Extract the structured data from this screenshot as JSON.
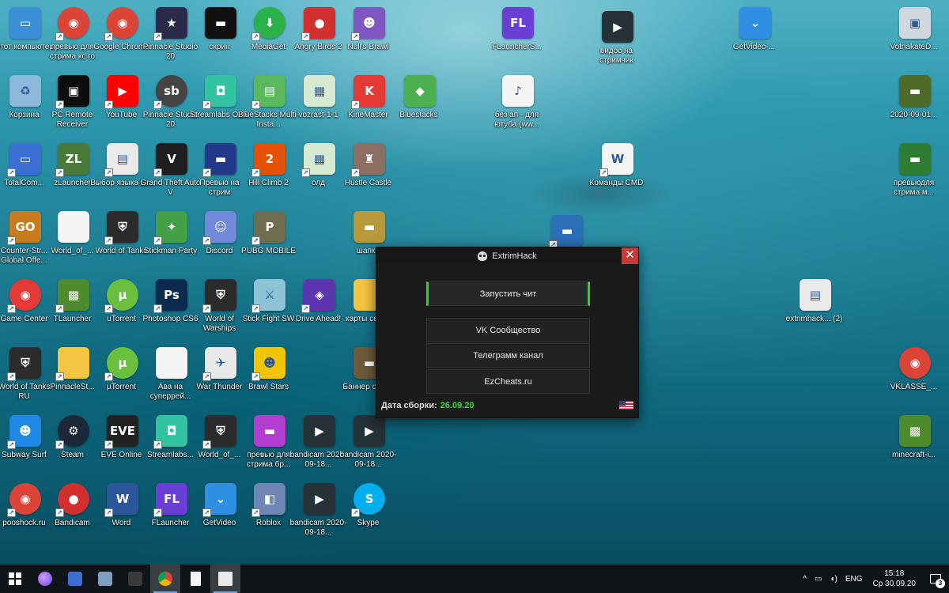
{
  "desktop": {
    "icons": [
      {
        "label": "Этот компьютер",
        "icon": "computer-icon",
        "color": "#3c8fd6",
        "glyph": "▭",
        "round": false,
        "shortcut": false
      },
      {
        "label": "превью для стрима кс го",
        "icon": "chrome-icon",
        "color": "#db4437",
        "glyph": "◉",
        "round": true,
        "shortcut": true
      },
      {
        "label": "Google Chrome",
        "icon": "chrome-icon",
        "color": "#db4437",
        "glyph": "◉",
        "round": true,
        "shortcut": true
      },
      {
        "label": "Pinnacle Studio 20",
        "icon": "pinnacle-icon",
        "color": "#2a2a4a",
        "glyph": "★",
        "round": false,
        "shortcut": true
      },
      {
        "label": "скрин",
        "icon": "image-icon",
        "color": "#111111",
        "glyph": "▬",
        "round": false,
        "shortcut": false
      },
      {
        "label": "MediaGet",
        "icon": "mediaget-icon",
        "color": "#2bb14a",
        "glyph": "⬇",
        "round": true,
        "shortcut": true
      },
      {
        "label": "Angry Birds 2",
        "icon": "angry-birds-icon",
        "color": "#d32f2f",
        "glyph": "●",
        "round": false,
        "shortcut": true
      },
      {
        "label": "Null's Brawl",
        "icon": "nulls-brawl-icon",
        "color": "#7e57c2",
        "glyph": "☻",
        "round": false,
        "shortcut": true
      },
      {
        "label": "Корзина",
        "icon": "recycle-bin-icon",
        "color": "#8fb7d9",
        "glyph": "♻",
        "round": false,
        "shortcut": false
      },
      {
        "label": "PC Remote Receiver",
        "icon": "pc-remote-icon",
        "color": "#0d0d0d",
        "glyph": "▣",
        "round": false,
        "shortcut": true
      },
      {
        "label": "YouTube",
        "icon": "youtube-icon",
        "color": "#ff0000",
        "glyph": "▶",
        "round": false,
        "shortcut": true
      },
      {
        "label": "Pinnacle Studio 20",
        "icon": "pinnacle-sb-icon",
        "color": "#444444",
        "glyph": "sb",
        "round": true,
        "shortcut": true
      },
      {
        "label": "Streamlabs OBS",
        "icon": "streamlabs-icon",
        "color": "#31c3a2",
        "glyph": "◘",
        "round": false,
        "shortcut": true
      },
      {
        "label": "BlueStacks Multi-Insta...",
        "icon": "bluestacks-icon",
        "color": "#5cb85c",
        "glyph": "▤",
        "round": false,
        "shortcut": true
      },
      {
        "label": "vozrast-1-1",
        "icon": "spreadsheet-icon",
        "color": "#d9ead3",
        "glyph": "▦",
        "round": false,
        "shortcut": false
      },
      {
        "label": "KineMaster",
        "icon": "kinemaster-icon",
        "color": "#e53935",
        "glyph": "K",
        "round": false,
        "shortcut": true
      },
      {
        "label": "Bluestacks",
        "icon": "bluestacks-stack-icon",
        "color": "#4caf50",
        "glyph": "◆",
        "round": false,
        "shortcut": false
      },
      {
        "label": "TotalCom...",
        "icon": "floppy-icon",
        "color": "#3b6fd4",
        "glyph": "▭",
        "round": false,
        "shortcut": true
      },
      {
        "label": "zLauncher",
        "icon": "zlauncher-icon",
        "color": "#4a7a3a",
        "glyph": "ZL",
        "round": false,
        "shortcut": true
      },
      {
        "label": "Выбор языка S...",
        "icon": "window-icon",
        "color": "#eaeaea",
        "glyph": "▤",
        "round": false,
        "shortcut": true
      },
      {
        "label": "Grand Theft Auto V",
        "icon": "gta-icon",
        "color": "#1e1e1e",
        "glyph": "V",
        "round": false,
        "shortcut": true
      },
      {
        "label": "Превью на стрим",
        "icon": "image-icon",
        "color": "#233a8a",
        "glyph": "▬",
        "round": false,
        "shortcut": true
      },
      {
        "label": "Hill Climb 2",
        "icon": "hill-climb-icon",
        "color": "#e65100",
        "glyph": "2",
        "round": false,
        "shortcut": true
      },
      {
        "label": "олд",
        "icon": "spreadsheet-icon",
        "color": "#d9ead3",
        "glyph": "▦",
        "round": false,
        "shortcut": true
      },
      {
        "label": "Hustle Castle",
        "icon": "hustle-castle-icon",
        "color": "#8d6e63",
        "glyph": "♜",
        "round": false,
        "shortcut": true
      },
      {
        "label": "Counter-Str... Global Offe...",
        "icon": "csgo-icon",
        "color": "#c77d1e",
        "glyph": "GO",
        "round": false,
        "shortcut": true
      },
      {
        "label": "World_of_...",
        "icon": "file-icon",
        "color": "#f5f5f5",
        "glyph": "",
        "round": false,
        "shortcut": false
      },
      {
        "label": "World of Tanks",
        "icon": "wot-icon",
        "color": "#2b2b2b",
        "glyph": "⛨",
        "round": false,
        "shortcut": true
      },
      {
        "label": "Stickman Party",
        "icon": "stickman-icon",
        "color": "#43a047",
        "glyph": "✦",
        "round": false,
        "shortcut": true
      },
      {
        "label": "Discord",
        "icon": "discord-icon",
        "color": "#7289da",
        "glyph": "☺",
        "round": false,
        "shortcut": true
      },
      {
        "label": "PUBG MOBILE",
        "icon": "pubg-icon",
        "color": "#6d6d4f",
        "glyph": "P",
        "round": false,
        "shortcut": true
      },
      {
        "label": "шапка",
        "icon": "image-icon",
        "color": "#b89a3a",
        "glyph": "▬",
        "round": false,
        "shortcut": false
      },
      {
        "label": "Game Center",
        "icon": "game-center-icon",
        "color": "#e53935",
        "glyph": "◉",
        "round": true,
        "shortcut": true
      },
      {
        "label": "TLauncher",
        "icon": "tlauncher-icon",
        "color": "#4e8b2c",
        "glyph": "▩",
        "round": false,
        "shortcut": true
      },
      {
        "label": "uTorrent",
        "icon": "utorrent-icon",
        "color": "#6abf3f",
        "glyph": "µ",
        "round": true,
        "shortcut": true
      },
      {
        "label": "Photoshop CS6",
        "icon": "photoshop-icon",
        "color": "#0b2a4e",
        "glyph": "Ps",
        "round": false,
        "shortcut": true
      },
      {
        "label": "World of Warships",
        "icon": "wows-icon",
        "color": "#2b2b2b",
        "glyph": "⛨",
        "round": false,
        "shortcut": true
      },
      {
        "label": "Stick Fight SW",
        "icon": "stick-fight-icon",
        "color": "#8ec3d6",
        "glyph": "⚔",
        "round": false,
        "shortcut": true
      },
      {
        "label": "Drive Ahead!",
        "icon": "drive-ahead-icon",
        "color": "#5e35b1",
        "glyph": "◈",
        "round": false,
        "shortcut": true
      },
      {
        "label": "карты серве",
        "icon": "folder-icon",
        "color": "#f4c542",
        "glyph": "",
        "round": false,
        "shortcut": false
      },
      {
        "label": "World of Tanks RU",
        "icon": "wot-icon",
        "color": "#2b2b2b",
        "glyph": "⛨",
        "round": false,
        "shortcut": true
      },
      {
        "label": "PinnacleSt...",
        "icon": "folder-icon",
        "color": "#f4c542",
        "glyph": "",
        "round": false,
        "shortcut": true
      },
      {
        "label": "µTorrent",
        "icon": "utorrent-icon",
        "color": "#6abf3f",
        "glyph": "µ",
        "round": true,
        "shortcut": true
      },
      {
        "label": "Ава на суперрей...",
        "icon": "file-icon",
        "color": "#f5f5f5",
        "glyph": "",
        "round": false,
        "shortcut": false
      },
      {
        "label": "War Thunder",
        "icon": "war-thunder-icon",
        "color": "#e8e8e8",
        "glyph": "✈",
        "round": false,
        "shortcut": true
      },
      {
        "label": "Brawl Stars",
        "icon": "brawl-stars-icon",
        "color": "#f5c400",
        "glyph": "☻",
        "round": false,
        "shortcut": true
      },
      {
        "label": "Баннер серве",
        "icon": "image-icon",
        "color": "#6d5b3a",
        "glyph": "▬",
        "round": false,
        "shortcut": false
      },
      {
        "label": "Subway Surf",
        "icon": "subway-surf-icon",
        "color": "#1e88e5",
        "glyph": "☻",
        "round": false,
        "shortcut": true
      },
      {
        "label": "Steam",
        "icon": "steam-icon",
        "color": "#1b2838",
        "glyph": "⚙",
        "round": true,
        "shortcut": true
      },
      {
        "label": "EVE Online",
        "icon": "eve-icon",
        "color": "#222222",
        "glyph": "EVE",
        "round": false,
        "shortcut": true
      },
      {
        "label": "Streamlabs...",
        "icon": "streamlabs-icon",
        "color": "#31c3a2",
        "glyph": "◘",
        "round": false,
        "shortcut": true
      },
      {
        "label": "World_of_...",
        "icon": "wot-icon",
        "color": "#2b2b2b",
        "glyph": "⛨",
        "round": false,
        "shortcut": true
      },
      {
        "label": "превью для стрима бр...",
        "icon": "image-icon",
        "color": "#b23fd1",
        "glyph": "▬",
        "round": false,
        "shortcut": false
      },
      {
        "label": "bandicam 2020-09-18...",
        "icon": "video-icon",
        "color": "#263238",
        "glyph": "▶",
        "round": false,
        "shortcut": false
      },
      {
        "label": "bandicam 2020-09-18...",
        "icon": "video-icon",
        "color": "#263238",
        "glyph": "▶",
        "round": false,
        "shortcut": false
      },
      {
        "label": "pooshock.ru",
        "icon": "chrome-icon",
        "color": "#db4437",
        "glyph": "◉",
        "round": true,
        "shortcut": true
      },
      {
        "label": "Bandicam",
        "icon": "bandicam-icon",
        "color": "#d32f2f",
        "glyph": "●",
        "round": true,
        "shortcut": true
      },
      {
        "label": "Word",
        "icon": "word-icon",
        "color": "#2b579a",
        "glyph": "W",
        "round": false,
        "shortcut": true
      },
      {
        "label": "FLauncher",
        "icon": "flauncher-icon",
        "color": "#6a3fd6",
        "glyph": "FL",
        "round": false,
        "shortcut": true
      },
      {
        "label": "GetVideo",
        "icon": "getvideo-icon",
        "color": "#2f8fe3",
        "glyph": "⌄",
        "round": false,
        "shortcut": true
      },
      {
        "label": "Roblox",
        "icon": "roblox-icon",
        "color": "#6f86b5",
        "glyph": "◧",
        "round": false,
        "shortcut": true
      },
      {
        "label": "bandicam 2020-09-18...",
        "icon": "video-icon",
        "color": "#263238",
        "glyph": "▶",
        "round": false,
        "shortcut": false
      },
      {
        "label": "Skype",
        "icon": "skype-icon",
        "color": "#00aff0",
        "glyph": "S",
        "round": true,
        "shortcut": true
      },
      {
        "label": "FLauncherS...",
        "icon": "flauncher-icon",
        "color": "#6a3fd6",
        "glyph": "FL",
        "round": false,
        "shortcut": false
      },
      {
        "label": "видос на стримчик",
        "icon": "video-icon",
        "color": "#263238",
        "glyph": "▶",
        "round": false,
        "shortcut": false
      },
      {
        "label": "без ап - для ютуба (ww...",
        "icon": "mp3-icon",
        "color": "#f5f5f5",
        "glyph": "♪",
        "round": false,
        "shortcut": false
      },
      {
        "label": "Команды CMD",
        "icon": "word-doc-icon",
        "color": "#f5f5f5",
        "glyph": "W",
        "round": false,
        "shortcut": true
      },
      {
        "label": "картинка",
        "icon": "image-icon",
        "color": "#2a6fb8",
        "glyph": "▬",
        "round": false,
        "shortcut": true
      },
      {
        "label": "GetVideo-...",
        "icon": "getvideo-icon",
        "color": "#2f8fe3",
        "glyph": "⌄",
        "round": false,
        "shortcut": false
      },
      {
        "label": "extrimhack... (2)",
        "icon": "window-icon",
        "color": "#eaeaea",
        "glyph": "▤",
        "round": false,
        "shortcut": false
      },
      {
        "label": "VotnakateD...",
        "icon": "installer-icon",
        "color": "#cfd8dc",
        "glyph": "▣",
        "round": false,
        "shortcut": false
      },
      {
        "label": "2020-09-01...",
        "icon": "image-icon",
        "color": "#4e6b2a",
        "glyph": "▬",
        "round": false,
        "shortcut": false
      },
      {
        "label": "превьюдля стрима м...",
        "icon": "image-icon",
        "color": "#2e7d32",
        "glyph": "▬",
        "round": false,
        "shortcut": false
      },
      {
        "label": "VKLASSE_...",
        "icon": "chrome-icon",
        "color": "#db4437",
        "glyph": "◉",
        "round": true,
        "shortcut": false
      },
      {
        "label": "minecraft-i...",
        "icon": "minecraft-icon",
        "color": "#4e8b2c",
        "glyph": "▩",
        "round": false,
        "shortcut": false
      }
    ]
  },
  "hack_window": {
    "title": "ExtrimHack",
    "close_glyph": "✕",
    "buttons": {
      "launch": "Запустить чит",
      "vk": "VK Сообщество",
      "telegram": "Телеграмм канал",
      "site": "EzCheats.ru"
    },
    "build_label": "Дата сборки:",
    "build_date": "26.09.20",
    "accent_color": "#2fd22f"
  },
  "taskbar": {
    "language": "ENG",
    "time": "15:18",
    "date": "Ср 30.09.20",
    "notification_count": "3",
    "tray_chevron": "^"
  }
}
